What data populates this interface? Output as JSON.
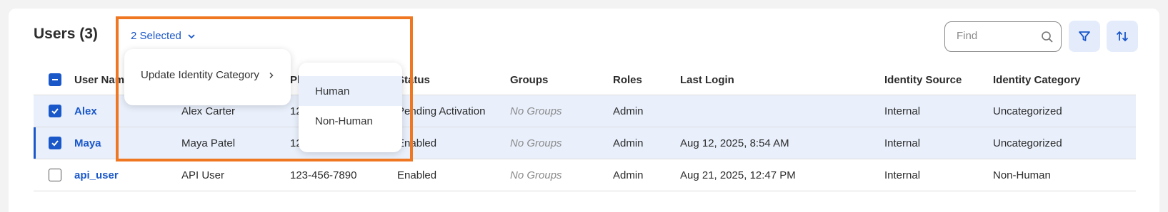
{
  "header": {
    "title": "Users (3)",
    "selected_label": "2 Selected",
    "find_placeholder": "Find"
  },
  "columns": [
    "User Name",
    "Phone",
    "Status",
    "Groups",
    "Roles",
    "Last Login",
    "Identity Source",
    "Identity Category"
  ],
  "rows": [
    {
      "user": "Alex",
      "name": "Alex Carter",
      "phone": "123-456-7890",
      "status": "Pending Activation",
      "groups": "No Groups",
      "roles": "Admin",
      "login": "",
      "source": "Internal",
      "category": "Uncategorized"
    },
    {
      "user": "Maya",
      "name": "Maya Patel",
      "phone": "123-456-7890",
      "status": "Enabled",
      "groups": "No Groups",
      "roles": "Admin",
      "login": "Aug 12, 2025, 8:54 AM",
      "source": "Internal",
      "category": "Uncategorized"
    },
    {
      "user": "api_user",
      "name": "API User",
      "phone": "123-456-7890",
      "status": "Enabled",
      "groups": "No Groups",
      "roles": "Admin",
      "login": "Aug 21, 2025, 12:47 PM",
      "source": "Internal",
      "category": "Non-Human"
    }
  ],
  "menu": {
    "item_label": "Update Identity Category",
    "submenu": [
      "Human",
      "Non-Human"
    ]
  },
  "icons": [
    "chevron-down-icon",
    "search-icon",
    "filter-icon",
    "sort-icon",
    "checkbox-check-icon",
    "chevron-right-icon"
  ],
  "colors": {
    "accent": "#1a57c9",
    "highlight": "#f07722",
    "selected_row": "#e9f0fc"
  }
}
